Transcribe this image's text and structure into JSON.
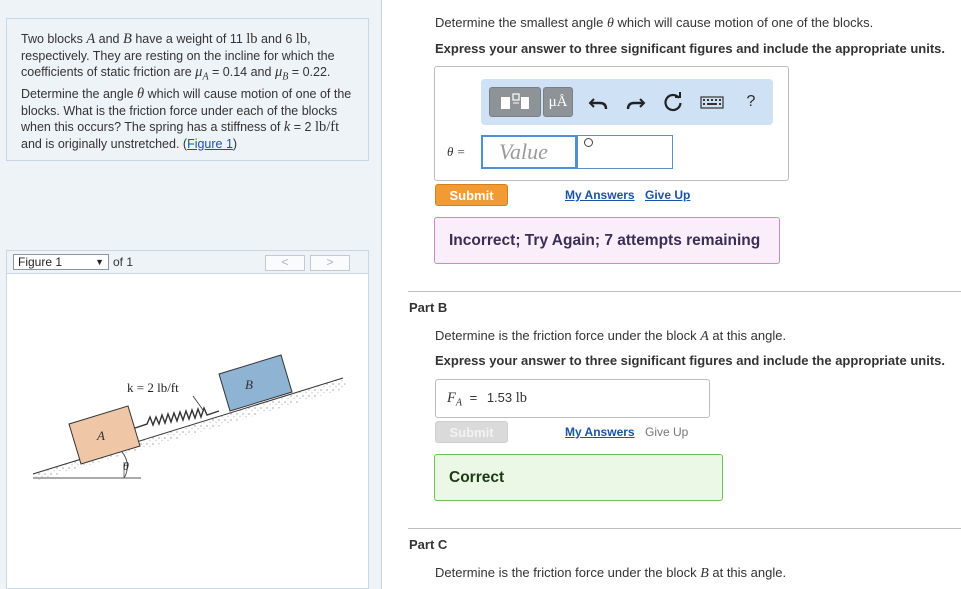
{
  "problem": {
    "p1": "Two blocks ",
    "blockA": "A",
    "p2": " and ",
    "blockB": "B",
    "p3": " have a weight of 11 ",
    "lb1": "lb",
    "p4": " and 6 ",
    "lb2": "lb",
    "p5": ", respectively. They are resting on the incline for which the coefficients of static friction are ",
    "muA": "μ",
    "muAsub": "A",
    "p6": " = 0.14 and ",
    "muB": "μ",
    "muBsub": "B",
    "p7": " = 0.22. Determine the angle ",
    "theta": "θ",
    "p8": " which will cause motion of one of the blocks. What is the friction force under each of the blocks when this occurs? The spring has a stiffness of ",
    "k": "k",
    "p9": " = 2 ",
    "unit": "lb/ft",
    "p10": " and is originally unstretched. (",
    "figure_link": "Figure 1",
    "p11": ")"
  },
  "figure_nav": {
    "selected": "Figure 1",
    "of_label": "of 1",
    "prev": "<",
    "next": ">"
  },
  "figure": {
    "spring_label": "k = 2 lb/ft",
    "block_a": "A",
    "block_b": "B",
    "angle": "θ"
  },
  "colors": {
    "block_a": "#f0c7a6",
    "block_b": "#8fb3d3",
    "submit_active": "#f29b34",
    "incorrect_bg": "#fbeefb",
    "correct_bg": "#ebf8e6",
    "link": "#1a54a6"
  },
  "part_a": {
    "prompt_1": "Determine the smallest angle ",
    "prompt_theta": "θ",
    "prompt_2": " which will cause motion of one of the blocks.",
    "instruction": "Express your answer to three significant figures and include the appropriate units.",
    "toolbar": {
      "templates_icon": "templates-icon",
      "units_label": "μÅ",
      "undo_icon": "undo-icon",
      "redo_icon": "redo-icon",
      "reset_icon": "reset-icon",
      "keyboard_icon": "keyboard-icon",
      "help_label": "?"
    },
    "variable": "θ =",
    "value_placeholder": "Value",
    "submit": "Submit",
    "my_answers": "My Answers",
    "give_up": "Give Up",
    "feedback": "Incorrect; Try Again; 7 attempts remaining"
  },
  "part_b": {
    "label": "Part B",
    "prompt_1": "Determine is the friction force under the block ",
    "prompt_block": "A",
    "prompt_2": " at this angle.",
    "instruction": "Express your answer to three significant figures and include the appropriate units.",
    "variable_main": "F",
    "variable_sub": "A",
    "equals": "=",
    "answer_value": "1.53",
    "answer_unit": "lb",
    "submit": "Submit",
    "my_answers": "My Answers",
    "give_up": "Give Up",
    "feedback": "Correct"
  },
  "part_c": {
    "label": "Part C",
    "prompt_1": "Determine is the friction force under the block ",
    "prompt_block": "B",
    "prompt_2": " at this angle."
  }
}
